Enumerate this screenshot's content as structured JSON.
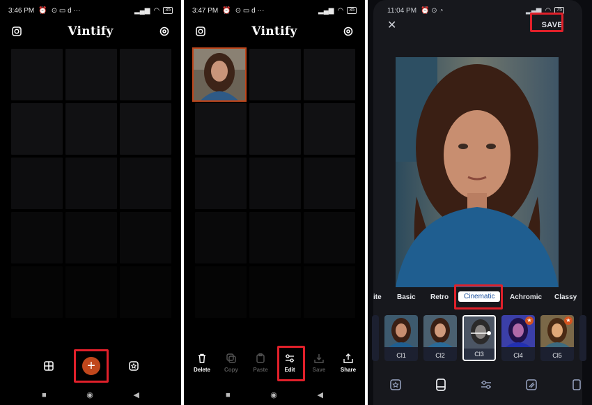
{
  "screens": [
    {
      "status": {
        "time": "3:46 PM",
        "battery": "35"
      },
      "app_title": "Vintify",
      "icons": {
        "top_left": "instagram-icon",
        "top_right": "settings-icon",
        "bottom_left": "layout-icon",
        "center": "add-icon",
        "bottom_right": "favorites-icon"
      }
    },
    {
      "status": {
        "time": "3:47 PM",
        "battery": "35"
      },
      "app_title": "Vintify",
      "toolbar": [
        {
          "label": "Delete",
          "icon": "trash-icon",
          "enabled": true
        },
        {
          "label": "Copy",
          "icon": "copy-icon",
          "enabled": false
        },
        {
          "label": "Paste",
          "icon": "paste-icon",
          "enabled": false
        },
        {
          "label": "Edit",
          "icon": "sliders-icon",
          "enabled": true,
          "highlighted": true
        },
        {
          "label": "Save",
          "icon": "download-icon",
          "enabled": false
        },
        {
          "label": "Share",
          "icon": "share-icon",
          "enabled": true
        }
      ]
    },
    {
      "status": {
        "time": "11:04 PM",
        "battery": "75"
      },
      "save_label": "SAVE",
      "filter_tabs": [
        {
          "label": "ite"
        },
        {
          "label": "Basic"
        },
        {
          "label": "Retro"
        },
        {
          "label": "Cinematic",
          "active": true
        },
        {
          "label": "Achromic"
        },
        {
          "label": "Classy"
        }
      ],
      "presets": [
        {
          "label": "Cl1",
          "premium": false
        },
        {
          "label": "Cl2",
          "premium": false
        },
        {
          "label": "Cl3",
          "premium": false,
          "selected": true
        },
        {
          "label": "Cl4",
          "premium": true
        },
        {
          "label": "Cl5",
          "premium": true
        }
      ],
      "colors": {
        "accent": "#c0471c",
        "highlight": "#e0202a",
        "active_tab_text": "#1b4f9c"
      }
    }
  ]
}
